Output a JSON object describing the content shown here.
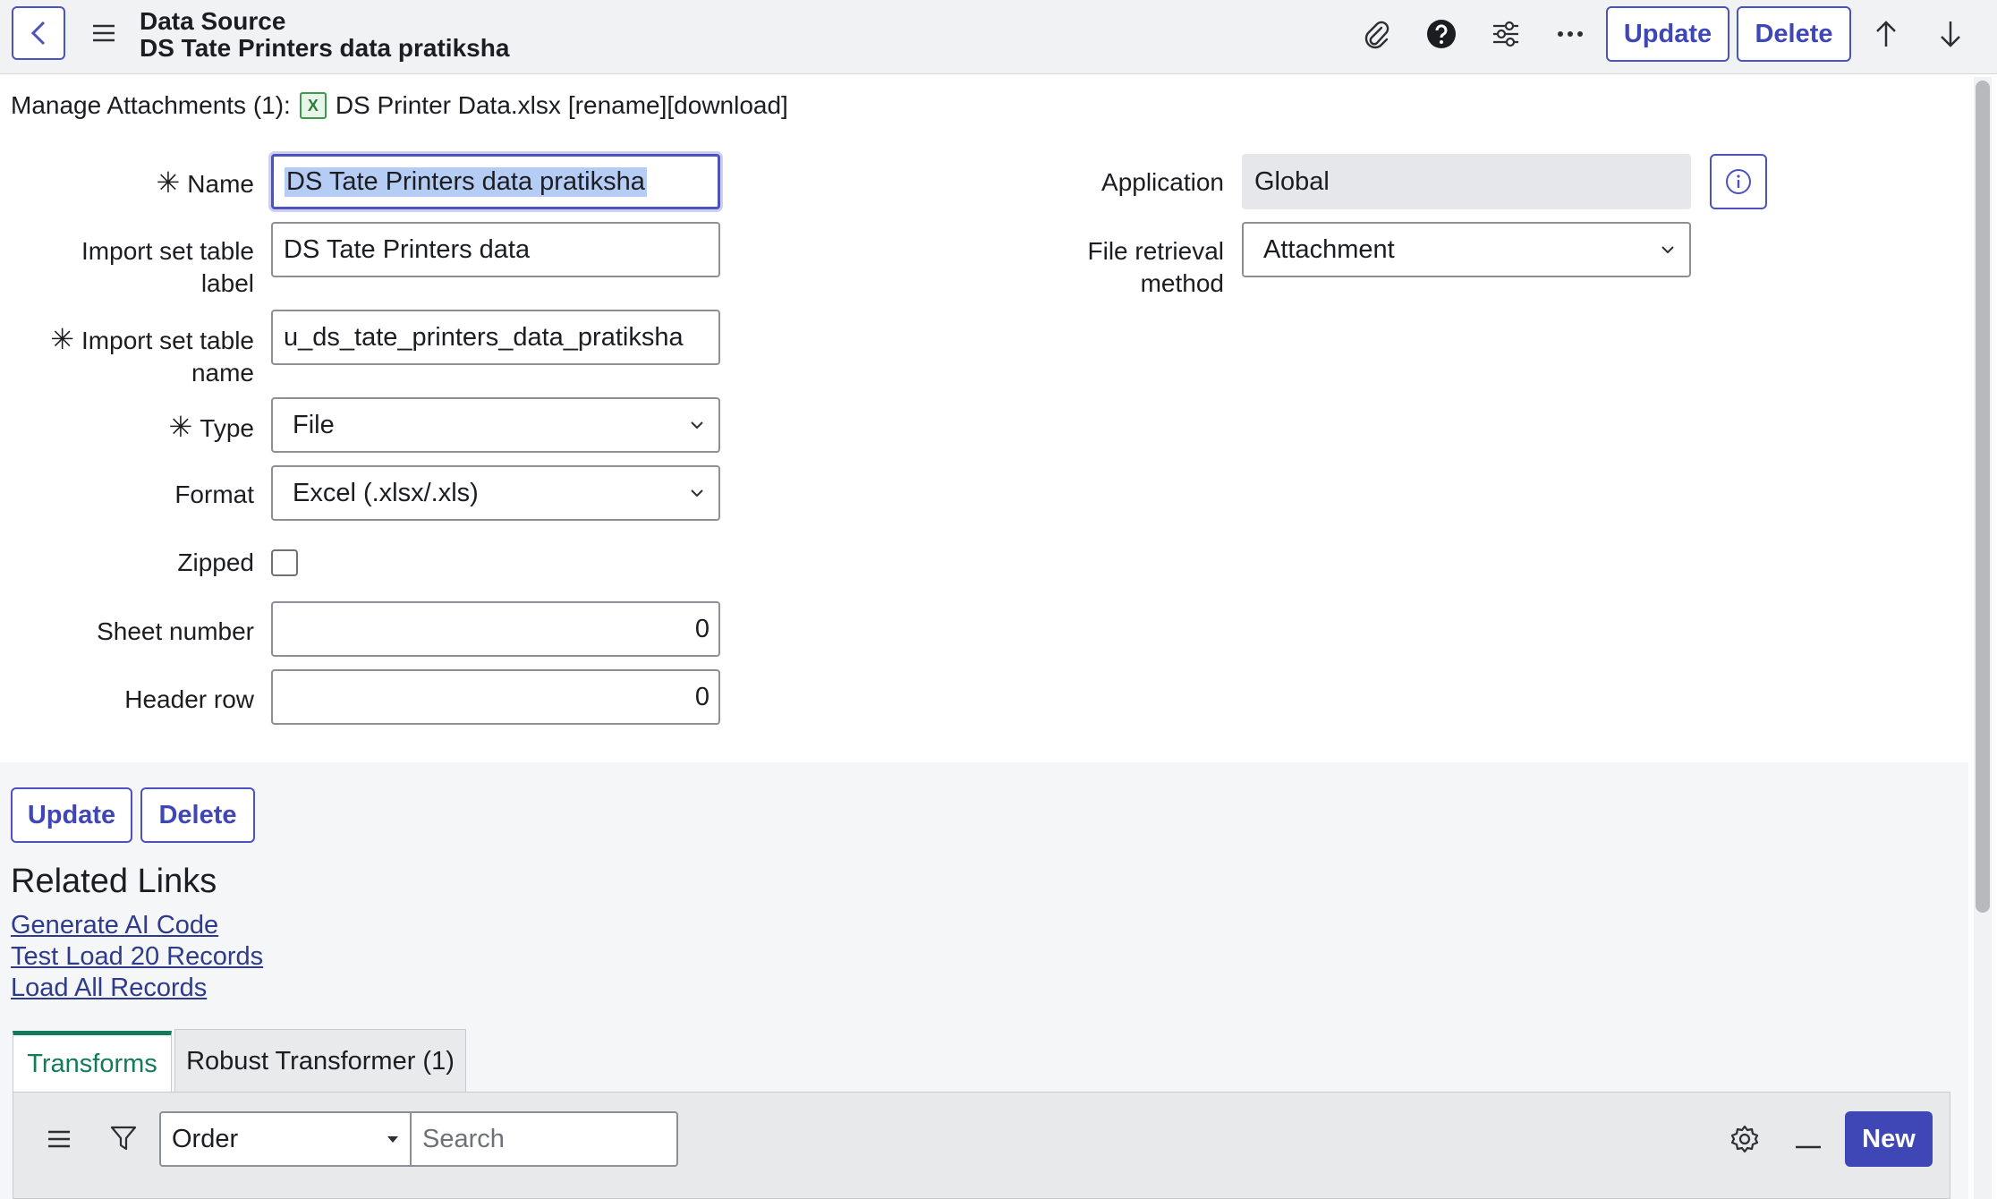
{
  "header": {
    "record_type": "Data Source",
    "record_name": "DS Tate Printers data pratiksha",
    "update_label": "Update",
    "delete_label": "Delete"
  },
  "attachments": {
    "label": "Manage Attachments (1):",
    "file_name": "DS Printer Data.xlsx",
    "rename_label": "[rename]",
    "download_label": "[download]"
  },
  "form": {
    "required_marker": "✳",
    "name": {
      "label": "Name",
      "value": "DS Tate  Printers data pratiksha"
    },
    "import_label": {
      "label_line1": "Import set table",
      "label_line2": "label",
      "value": "DS Tate  Printers data"
    },
    "import_name": {
      "label_line1": "Import set table",
      "label_line2": "name",
      "value": "u_ds_tate_printers_data_pratiksha"
    },
    "type": {
      "label": "Type",
      "value": "File"
    },
    "format": {
      "label": "Format",
      "value": "Excel (.xlsx/.xls)"
    },
    "zipped": {
      "label": "Zipped",
      "checked": false
    },
    "sheet_number": {
      "label": "Sheet number",
      "value": "0"
    },
    "header_row": {
      "label": "Header row",
      "value": "0"
    },
    "application": {
      "label": "Application",
      "value": "Global"
    },
    "file_retrieval": {
      "label_line1": "File retrieval",
      "label_line2": "method",
      "value": "Attachment"
    }
  },
  "actions": {
    "update_label": "Update",
    "delete_label": "Delete"
  },
  "related_links": {
    "title": "Related Links",
    "items": [
      "Generate AI Code",
      "Test Load 20 Records",
      "Load All Records"
    ]
  },
  "tabs": [
    {
      "label": "Transforms",
      "active": true
    },
    {
      "label": "Robust Transformer (1)",
      "active": false
    }
  ],
  "list": {
    "order_label": "Order",
    "search_placeholder": "Search",
    "new_label": "New"
  },
  "colors": {
    "accent": "#4c52bf",
    "active_tab": "#137a5a",
    "link": "#2e3a8c"
  }
}
